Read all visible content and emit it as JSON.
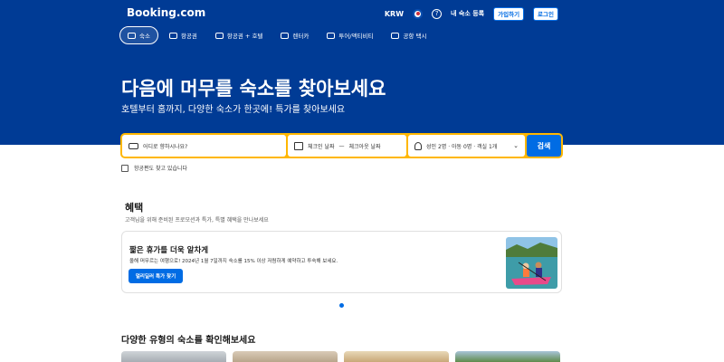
{
  "header": {
    "logo": "Booking.com",
    "currency": "KRW",
    "help_icon": "question-circle-icon",
    "list_property": "내 숙소 등록",
    "register": "가입하기",
    "signin": "로그인"
  },
  "nav_tabs": [
    {
      "label": "숙소",
      "icon": "bed-icon",
      "active": true
    },
    {
      "label": "항공권",
      "icon": "plane-icon",
      "active": false
    },
    {
      "label": "항공권 + 호텔",
      "icon": "plane-hotel-icon",
      "active": false
    },
    {
      "label": "렌터카",
      "icon": "car-icon",
      "active": false
    },
    {
      "label": "투어/액티비티",
      "icon": "attraction-icon",
      "active": false
    },
    {
      "label": "공항 택시",
      "icon": "taxi-icon",
      "active": false
    }
  ],
  "hero": {
    "title": "다음에 머무를 숙소를 찾아보세요",
    "subtitle": "호텔부터 홈까지, 다양한 숙소가 한곳에! 특가를 찾아보세요"
  },
  "search": {
    "destination_placeholder": "어디로 향하시나요?",
    "checkin": "체크인 날짜",
    "checkout": "체크아웃 날짜",
    "date_separator": "—",
    "guests": "성인 2명 · 아동 0명 · 객실 1개",
    "search_button": "검색",
    "flights_checkbox": "항공편도 찾고 있습니다"
  },
  "offers": {
    "title": "혜택",
    "subtitle": "고객님을 위해 준비된 프로모션과 특가, 특별 혜택을 만나보세요",
    "card": {
      "title": "짧은 휴가를 더욱 알차게",
      "description": "올해 머무르는 여행으로! 2024년 1월 7일까지 숙소를 15% 이상 저렴하게 예약하고 투숙해 보세요.",
      "button": "얼리딜러 특가 찾기"
    }
  },
  "property_types": {
    "title": "다양한 유형의 숙소를 확인해보세요"
  },
  "colors": {
    "brand_blue": "#003b95",
    "accent_blue": "#006ce4",
    "search_border": "#ffb700"
  }
}
